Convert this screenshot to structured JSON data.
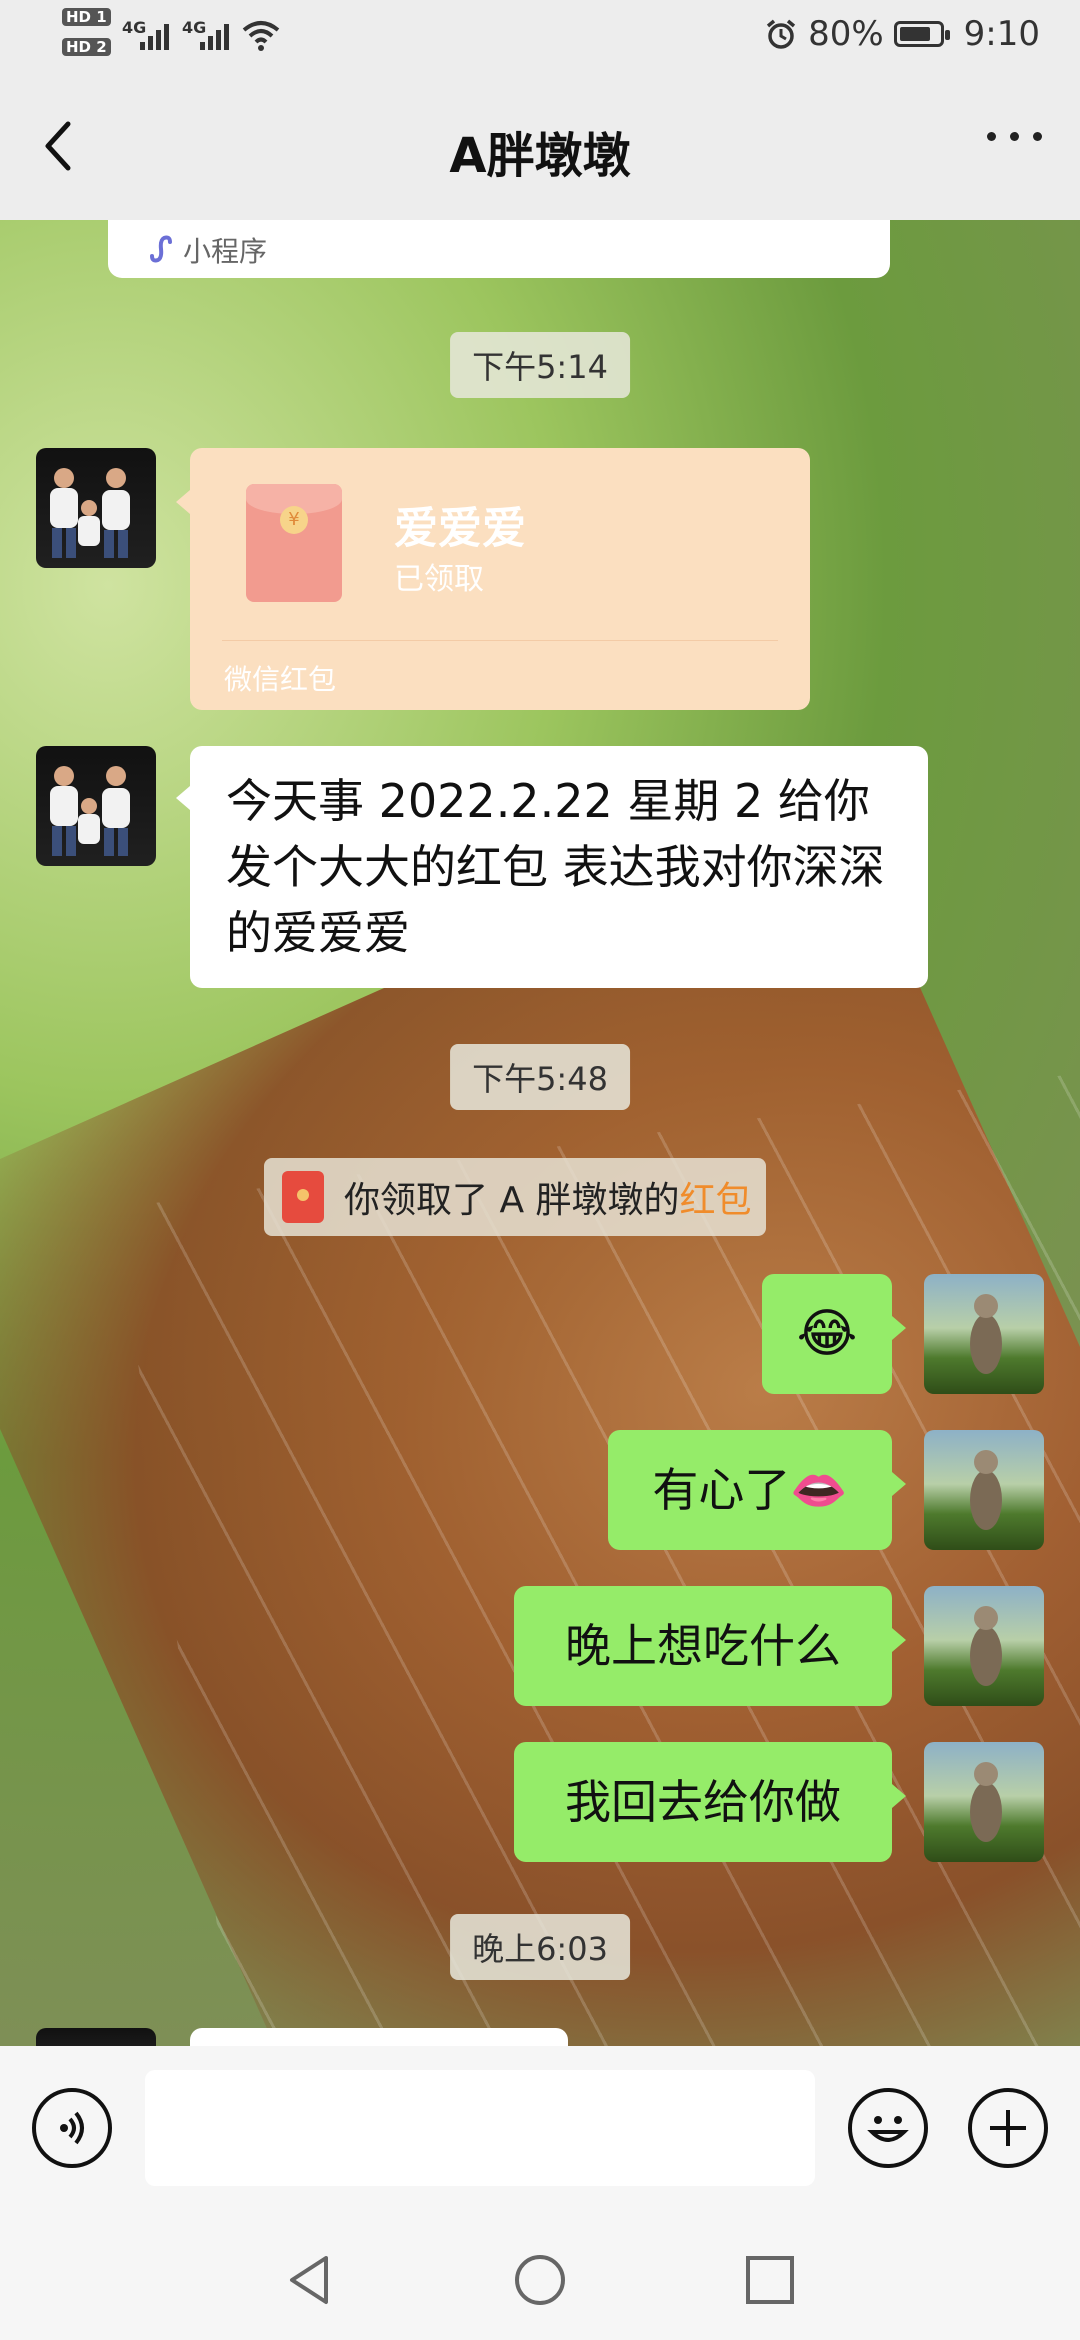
{
  "status_bar": {
    "sim1": "HD 1",
    "sim2": "HD 2",
    "network1": "4G",
    "network2": "4G",
    "battery": "80%",
    "battery_level": 0.8,
    "time": "9:10"
  },
  "header": {
    "title": "A胖墩墩",
    "back_icon": "chevron-left-icon",
    "more_icon": "more-dots-icon"
  },
  "chat": {
    "mini_program_label": "小程序",
    "timestamps": [
      "下午5:14",
      "下午5:48",
      "晚上6:03"
    ],
    "red_packet": {
      "title": "爱爱爱",
      "status": "已领取",
      "label": "微信红包"
    },
    "incoming_message": "今天事 2022.2.22 星期 2  给你发个大大的红包  表达我对你深深的爱爱爱",
    "system_note": {
      "prefix": "你领取了 A 胖墩墩的",
      "highlight": "红包"
    },
    "outgoing": [
      {
        "text": "😂"
      },
      {
        "text": "有心了👄"
      },
      {
        "text": "晚上想吃什么"
      },
      {
        "text": "我回去给你做"
      }
    ]
  },
  "composer": {
    "voice_icon": "voice-icon",
    "emoji_icon": "emoji-icon",
    "plus_icon": "plus-icon",
    "input_value": ""
  },
  "navigation": {
    "back": "triangle-back-icon",
    "home": "circle-home-icon",
    "recent": "square-recent-icon"
  },
  "colors": {
    "outgoing_bubble": "#95ec69",
    "red_packet": "#fbdfc0",
    "highlight": "#f08c2b"
  }
}
